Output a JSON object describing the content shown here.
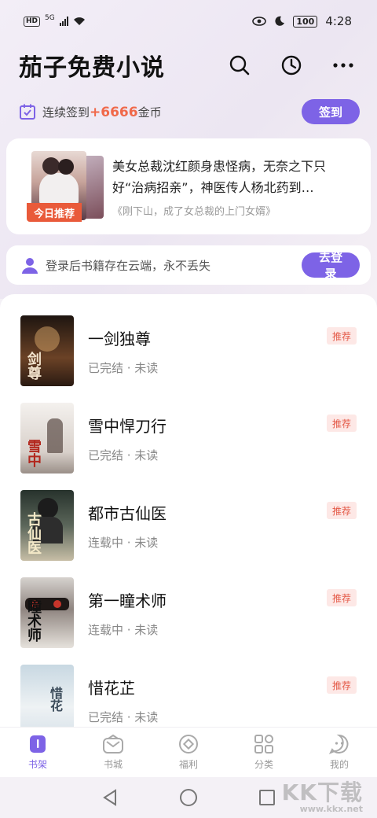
{
  "status_bar": {
    "hd": "HD",
    "net": "5G",
    "time": "4:28",
    "battery": "100"
  },
  "header": {
    "title": "茄子免费小说",
    "icons": [
      "search-icon",
      "history-clock-icon",
      "more-icon"
    ]
  },
  "checkin": {
    "prefix": "连续签到",
    "amount": "+6666",
    "suffix": "金币",
    "button": "签到"
  },
  "recommend": {
    "tag": "今日推荐",
    "description": "美女总裁沈红颜身患怪病，无奈之下只好“治病招亲”，神医传人杨北药到…",
    "book": "《刚下山，成了女总裁的上门女婿》"
  },
  "login": {
    "text": "登录后书籍存在云端，永不丢失",
    "button": "去登录"
  },
  "books": [
    {
      "title": "一剑独尊",
      "status": "已完结 · 未读",
      "tag": "推荐",
      "cover_text": "剑尊",
      "cover_colors": [
        "#2a1d16",
        "#8a5a38"
      ]
    },
    {
      "title": "雪中悍刀行",
      "status": "已完结 · 未读",
      "tag": "推荐",
      "cover_text": "雪中",
      "cover_colors": [
        "#f2eeea",
        "#b9b0aa"
      ]
    },
    {
      "title": "都市古仙医",
      "status": "连载中 · 未读",
      "tag": "推荐",
      "cover_text": "古仙医",
      "cover_colors": [
        "#3d4a42",
        "#c9c0a8"
      ]
    },
    {
      "title": "第一瞳术师",
      "status": "连载中 · 未读",
      "tag": "推荐",
      "cover_text": "瞳术师",
      "cover_colors": [
        "#d9d6d2",
        "#3a2f2c"
      ]
    },
    {
      "title": "惜花芷",
      "status": "已完结 · 未读",
      "tag": "推荐",
      "cover_text": "惜花",
      "cover_colors": [
        "#cfdde6",
        "#e9eef0"
      ]
    }
  ],
  "bottom_nav": [
    {
      "label": "书架",
      "icon": "bookshelf-icon",
      "active": true
    },
    {
      "label": "书城",
      "icon": "bookstore-icon",
      "active": false
    },
    {
      "label": "福利",
      "icon": "coin-icon",
      "active": false
    },
    {
      "label": "分类",
      "icon": "category-icon",
      "active": false
    },
    {
      "label": "我的",
      "icon": "profile-icon",
      "active": false
    }
  ],
  "colors": {
    "accent": "#7d63e6",
    "coin": "#f0694a",
    "tag_bg": "#fde8e6",
    "tag_text": "#e45a48"
  },
  "watermark": {
    "big": "KK下载",
    "small": "www.kkx.net"
  }
}
